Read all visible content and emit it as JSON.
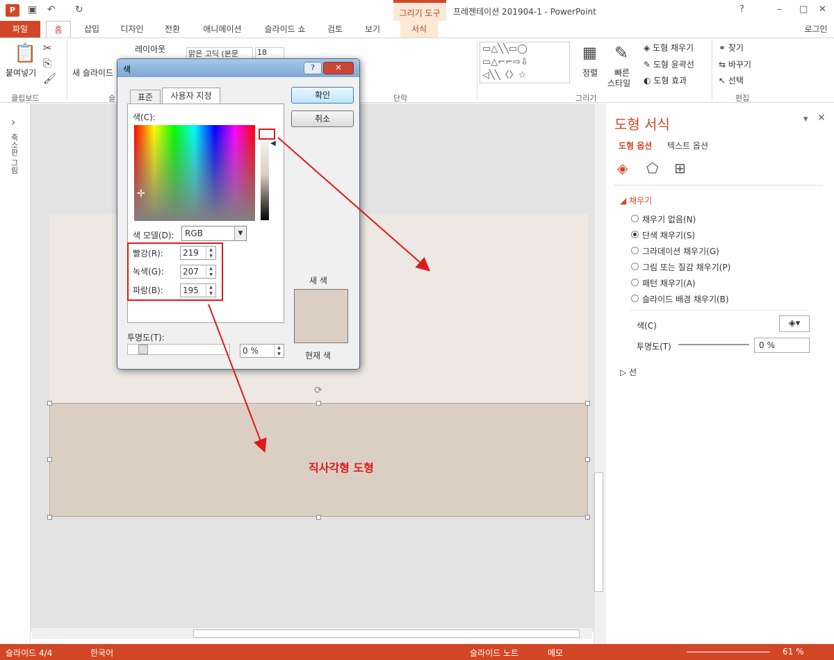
{
  "window": {
    "title": "프레젠테이션 201904-1 - PowerPoint",
    "context_tab": "그리기 도구",
    "app_icon": "P",
    "signin": "로그인"
  },
  "tabs": [
    "파일",
    "홈",
    "삽입",
    "디자인",
    "전환",
    "애니메이션",
    "슬라이드 쇼",
    "검토",
    "보기",
    "서식"
  ],
  "ribbon": {
    "paste": "붙여넣기",
    "new_slide": "새 슬라이드",
    "layout": "레이아웃",
    "font_name": "맑은 고딕 (본문",
    "font_size": "18",
    "arrange": "정렬",
    "quick_styles": "빠른",
    "quick_styles2": "스타일",
    "shape_fill": "도형 채우기",
    "shape_outline": "도형 윤곽선",
    "shape_effects": "도형 효과",
    "find": "찾기",
    "replace": "바꾸기",
    "select": "선택",
    "group_clipboard": "클립보드",
    "group_slides": "슬",
    "group_paragraph": "단락",
    "group_drawing": "그리기",
    "group_editing": "편집"
  },
  "left_pane": {
    "label": "축소판 그림",
    "arrow": "›"
  },
  "slide": {
    "shape_label": "직사각형 도형"
  },
  "dialog": {
    "title": "색",
    "help": "?",
    "close": "✕",
    "tab_standard": "표준",
    "tab_custom": "사용자 지정",
    "colors_label": "색(C):",
    "ok": "확인",
    "cancel": "취소",
    "color_model_label": "색 모델(D):",
    "color_model_value": "RGB",
    "red_label": "빨강(R):",
    "red_value": "219",
    "green_label": "녹색(G):",
    "green_value": "207",
    "blue_label": "파랑(B):",
    "blue_value": "195",
    "transparency_label": "투명도(T):",
    "transparency_value": "0 %",
    "new_label": "새 색",
    "current_label": "현재 색",
    "preview_color": "#dbcfc3"
  },
  "panel": {
    "title": "도형 서식",
    "tab_shape": "도형 옵션",
    "tab_text": "텍스트 옵션",
    "section_fill": "채우기",
    "fill_options": [
      "채우기 없음(N)",
      "단색 채우기(S)",
      "그라데이션 채우기(G)",
      "그림 또는 질감 채우기(P)",
      "패턴 채우기(A)",
      "슬라이드 배경 채우기(B)"
    ],
    "selected_option": 1,
    "color_label": "색(C)",
    "transparency_label": "투명도(T)",
    "transparency_value": "0 %",
    "section_line": "선",
    "close": "✕",
    "menu": "▾"
  },
  "status": {
    "slide": "슬라이드 4/4",
    "language": "한국어",
    "notes": "슬라이드 노트",
    "comments": "메모",
    "zoom": "61 %"
  },
  "colors": {
    "accent": "#d24726",
    "shape_fill": "#dbcfc3",
    "slide_bg": "#ede8e3",
    "annotation": "#e21818"
  }
}
